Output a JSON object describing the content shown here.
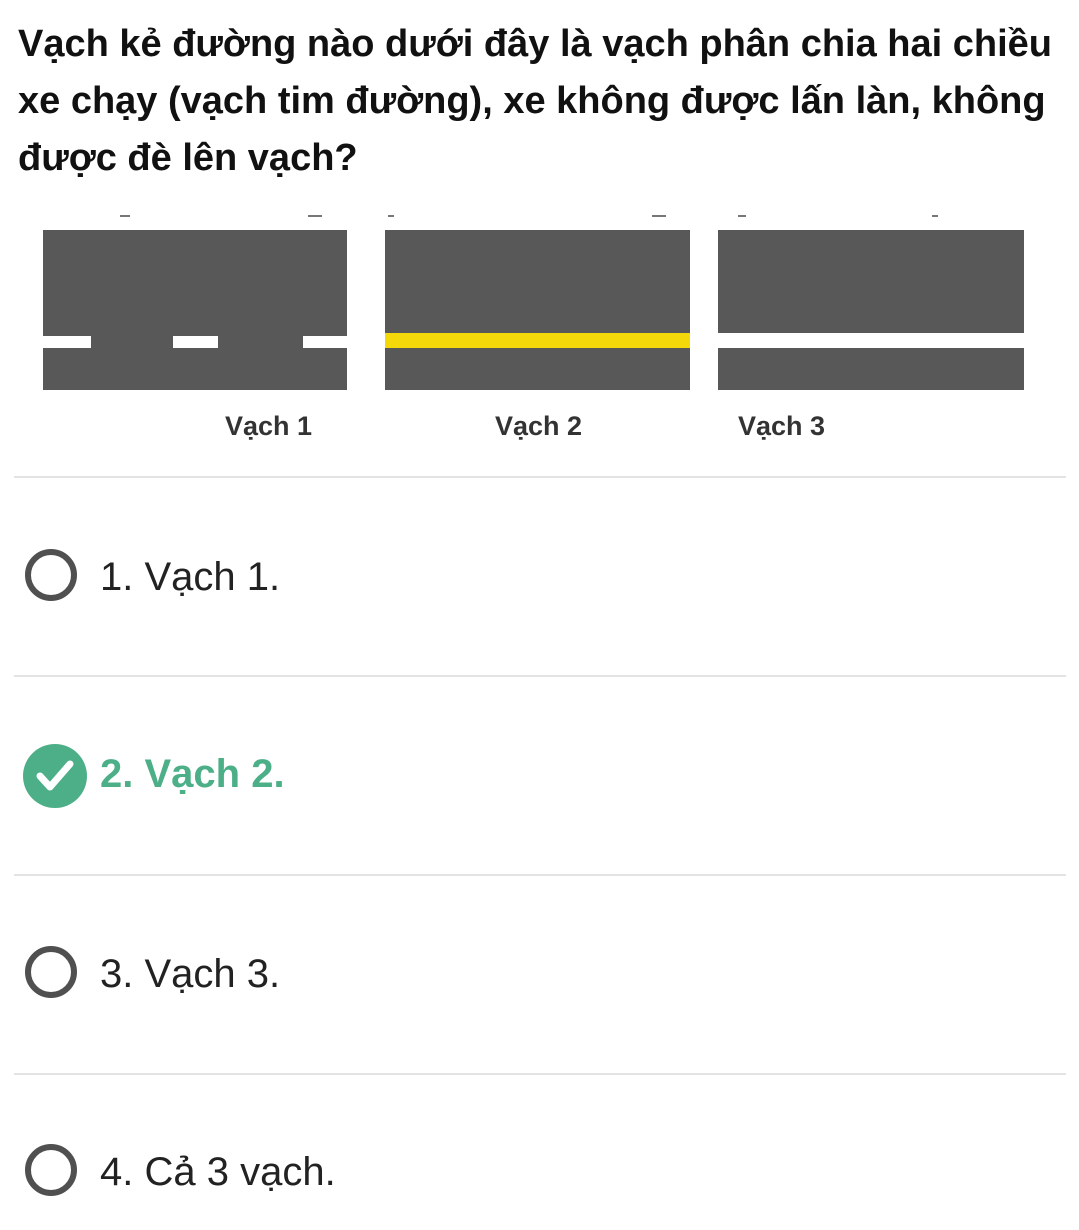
{
  "question": "Vạch kẻ đường nào dưới đây là vạch phân chia hai chiều xe chạy (vạch tim đường), xe không được lấn làn, không được đè lên vạch?",
  "figure": {
    "labels": [
      "Vạch 1",
      "Vạch 2",
      "Vạch 3"
    ],
    "colors": {
      "road": "#585858",
      "yellow_line": "#f5d80a",
      "white_line": "#ffffff"
    }
  },
  "options": [
    {
      "label": "1. Vạch 1.",
      "selected": false
    },
    {
      "label": "2. Vạch 2.",
      "selected": true,
      "correct": true
    },
    {
      "label": "3. Vạch 3.",
      "selected": false
    },
    {
      "label": "4. Cả 3 vạch.",
      "selected": false
    }
  ],
  "colors": {
    "correct": "#4caf88",
    "radio_border": "#505050"
  }
}
